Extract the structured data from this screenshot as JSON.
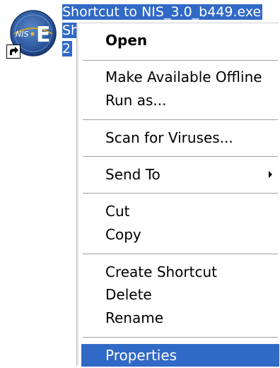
{
  "desktop": {
    "icon": {
      "name": "nis-elements-icon",
      "shortcut_overlay": "shortcut-arrow-icon",
      "label_lines": [
        "Shortcut to NIS_3.0_b449.exe",
        "Sh",
        "2"
      ]
    }
  },
  "context_menu": {
    "items": [
      {
        "label": "Open",
        "bold": true
      },
      {
        "label": "Make Available Offline"
      },
      {
        "label": "Run as..."
      },
      {
        "label": "Scan for Viruses..."
      },
      {
        "label": "Send To",
        "has_submenu": true
      },
      {
        "label": "Cut"
      },
      {
        "label": "Copy"
      },
      {
        "label": "Create Shortcut"
      },
      {
        "label": "Delete"
      },
      {
        "label": "Rename"
      },
      {
        "label": "Properties",
        "highlighted": true
      }
    ]
  },
  "colors": {
    "selection": "#3169c6",
    "menu_background": "#ffffff",
    "separator": "#a0a0a0"
  }
}
